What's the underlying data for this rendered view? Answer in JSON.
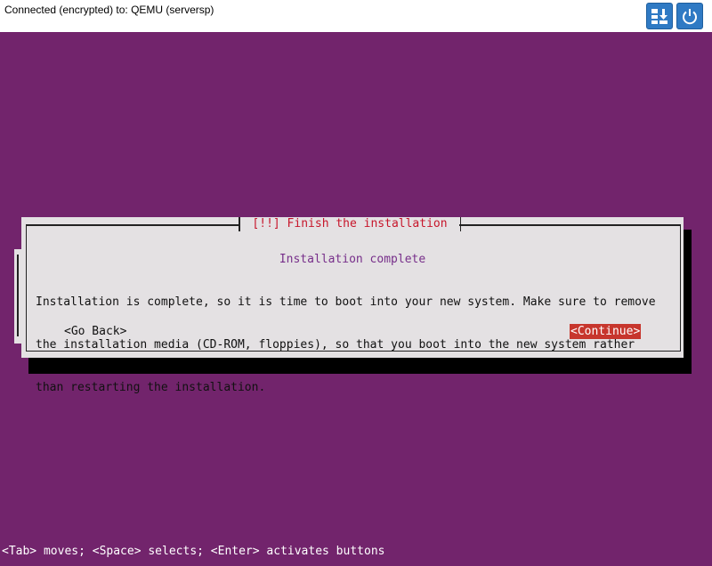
{
  "connection": {
    "status_text": "Connected (encrypted) to: QEMU (serversp)"
  },
  "toolbar": {
    "buttons": [
      {
        "name": "download",
        "icon": "download-icon"
      },
      {
        "name": "power",
        "icon": "power-icon"
      }
    ],
    "accent_color": "#2f7ac4"
  },
  "console": {
    "background_color": "#72246c",
    "dialog": {
      "title": "[!!] Finish the installation",
      "subtitle": "Installation complete",
      "body_lines": [
        "Installation is complete, so it is time to boot into your new system. Make sure to remove",
        "the installation media (CD-ROM, floppies), so that you boot into the new system rather",
        "than restarting the installation."
      ],
      "go_back_label": "<Go Back>",
      "continue_label": "<Continue>"
    },
    "status_line": "<Tab> moves; <Space> selects; <Enter> activates buttons"
  }
}
